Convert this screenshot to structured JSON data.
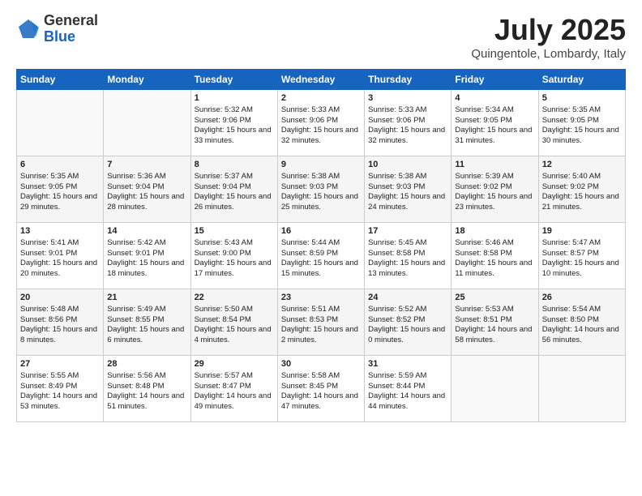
{
  "header": {
    "logo_general": "General",
    "logo_blue": "Blue",
    "month_title": "July 2025",
    "location": "Quingentole, Lombardy, Italy"
  },
  "weekdays": [
    "Sunday",
    "Monday",
    "Tuesday",
    "Wednesday",
    "Thursday",
    "Friday",
    "Saturday"
  ],
  "weeks": [
    [
      {
        "day": "",
        "sunrise": "",
        "sunset": "",
        "daylight": ""
      },
      {
        "day": "",
        "sunrise": "",
        "sunset": "",
        "daylight": ""
      },
      {
        "day": "1",
        "sunrise": "Sunrise: 5:32 AM",
        "sunset": "Sunset: 9:06 PM",
        "daylight": "Daylight: 15 hours and 33 minutes."
      },
      {
        "day": "2",
        "sunrise": "Sunrise: 5:33 AM",
        "sunset": "Sunset: 9:06 PM",
        "daylight": "Daylight: 15 hours and 32 minutes."
      },
      {
        "day": "3",
        "sunrise": "Sunrise: 5:33 AM",
        "sunset": "Sunset: 9:06 PM",
        "daylight": "Daylight: 15 hours and 32 minutes."
      },
      {
        "day": "4",
        "sunrise": "Sunrise: 5:34 AM",
        "sunset": "Sunset: 9:05 PM",
        "daylight": "Daylight: 15 hours and 31 minutes."
      },
      {
        "day": "5",
        "sunrise": "Sunrise: 5:35 AM",
        "sunset": "Sunset: 9:05 PM",
        "daylight": "Daylight: 15 hours and 30 minutes."
      }
    ],
    [
      {
        "day": "6",
        "sunrise": "Sunrise: 5:35 AM",
        "sunset": "Sunset: 9:05 PM",
        "daylight": "Daylight: 15 hours and 29 minutes."
      },
      {
        "day": "7",
        "sunrise": "Sunrise: 5:36 AM",
        "sunset": "Sunset: 9:04 PM",
        "daylight": "Daylight: 15 hours and 28 minutes."
      },
      {
        "day": "8",
        "sunrise": "Sunrise: 5:37 AM",
        "sunset": "Sunset: 9:04 PM",
        "daylight": "Daylight: 15 hours and 26 minutes."
      },
      {
        "day": "9",
        "sunrise": "Sunrise: 5:38 AM",
        "sunset": "Sunset: 9:03 PM",
        "daylight": "Daylight: 15 hours and 25 minutes."
      },
      {
        "day": "10",
        "sunrise": "Sunrise: 5:38 AM",
        "sunset": "Sunset: 9:03 PM",
        "daylight": "Daylight: 15 hours and 24 minutes."
      },
      {
        "day": "11",
        "sunrise": "Sunrise: 5:39 AM",
        "sunset": "Sunset: 9:02 PM",
        "daylight": "Daylight: 15 hours and 23 minutes."
      },
      {
        "day": "12",
        "sunrise": "Sunrise: 5:40 AM",
        "sunset": "Sunset: 9:02 PM",
        "daylight": "Daylight: 15 hours and 21 minutes."
      }
    ],
    [
      {
        "day": "13",
        "sunrise": "Sunrise: 5:41 AM",
        "sunset": "Sunset: 9:01 PM",
        "daylight": "Daylight: 15 hours and 20 minutes."
      },
      {
        "day": "14",
        "sunrise": "Sunrise: 5:42 AM",
        "sunset": "Sunset: 9:01 PM",
        "daylight": "Daylight: 15 hours and 18 minutes."
      },
      {
        "day": "15",
        "sunrise": "Sunrise: 5:43 AM",
        "sunset": "Sunset: 9:00 PM",
        "daylight": "Daylight: 15 hours and 17 minutes."
      },
      {
        "day": "16",
        "sunrise": "Sunrise: 5:44 AM",
        "sunset": "Sunset: 8:59 PM",
        "daylight": "Daylight: 15 hours and 15 minutes."
      },
      {
        "day": "17",
        "sunrise": "Sunrise: 5:45 AM",
        "sunset": "Sunset: 8:58 PM",
        "daylight": "Daylight: 15 hours and 13 minutes."
      },
      {
        "day": "18",
        "sunrise": "Sunrise: 5:46 AM",
        "sunset": "Sunset: 8:58 PM",
        "daylight": "Daylight: 15 hours and 11 minutes."
      },
      {
        "day": "19",
        "sunrise": "Sunrise: 5:47 AM",
        "sunset": "Sunset: 8:57 PM",
        "daylight": "Daylight: 15 hours and 10 minutes."
      }
    ],
    [
      {
        "day": "20",
        "sunrise": "Sunrise: 5:48 AM",
        "sunset": "Sunset: 8:56 PM",
        "daylight": "Daylight: 15 hours and 8 minutes."
      },
      {
        "day": "21",
        "sunrise": "Sunrise: 5:49 AM",
        "sunset": "Sunset: 8:55 PM",
        "daylight": "Daylight: 15 hours and 6 minutes."
      },
      {
        "day": "22",
        "sunrise": "Sunrise: 5:50 AM",
        "sunset": "Sunset: 8:54 PM",
        "daylight": "Daylight: 15 hours and 4 minutes."
      },
      {
        "day": "23",
        "sunrise": "Sunrise: 5:51 AM",
        "sunset": "Sunset: 8:53 PM",
        "daylight": "Daylight: 15 hours and 2 minutes."
      },
      {
        "day": "24",
        "sunrise": "Sunrise: 5:52 AM",
        "sunset": "Sunset: 8:52 PM",
        "daylight": "Daylight: 15 hours and 0 minutes."
      },
      {
        "day": "25",
        "sunrise": "Sunrise: 5:53 AM",
        "sunset": "Sunset: 8:51 PM",
        "daylight": "Daylight: 14 hours and 58 minutes."
      },
      {
        "day": "26",
        "sunrise": "Sunrise: 5:54 AM",
        "sunset": "Sunset: 8:50 PM",
        "daylight": "Daylight: 14 hours and 56 minutes."
      }
    ],
    [
      {
        "day": "27",
        "sunrise": "Sunrise: 5:55 AM",
        "sunset": "Sunset: 8:49 PM",
        "daylight": "Daylight: 14 hours and 53 minutes."
      },
      {
        "day": "28",
        "sunrise": "Sunrise: 5:56 AM",
        "sunset": "Sunset: 8:48 PM",
        "daylight": "Daylight: 14 hours and 51 minutes."
      },
      {
        "day": "29",
        "sunrise": "Sunrise: 5:57 AM",
        "sunset": "Sunset: 8:47 PM",
        "daylight": "Daylight: 14 hours and 49 minutes."
      },
      {
        "day": "30",
        "sunrise": "Sunrise: 5:58 AM",
        "sunset": "Sunset: 8:45 PM",
        "daylight": "Daylight: 14 hours and 47 minutes."
      },
      {
        "day": "31",
        "sunrise": "Sunrise: 5:59 AM",
        "sunset": "Sunset: 8:44 PM",
        "daylight": "Daylight: 14 hours and 44 minutes."
      },
      {
        "day": "",
        "sunrise": "",
        "sunset": "",
        "daylight": ""
      },
      {
        "day": "",
        "sunrise": "",
        "sunset": "",
        "daylight": ""
      }
    ]
  ]
}
